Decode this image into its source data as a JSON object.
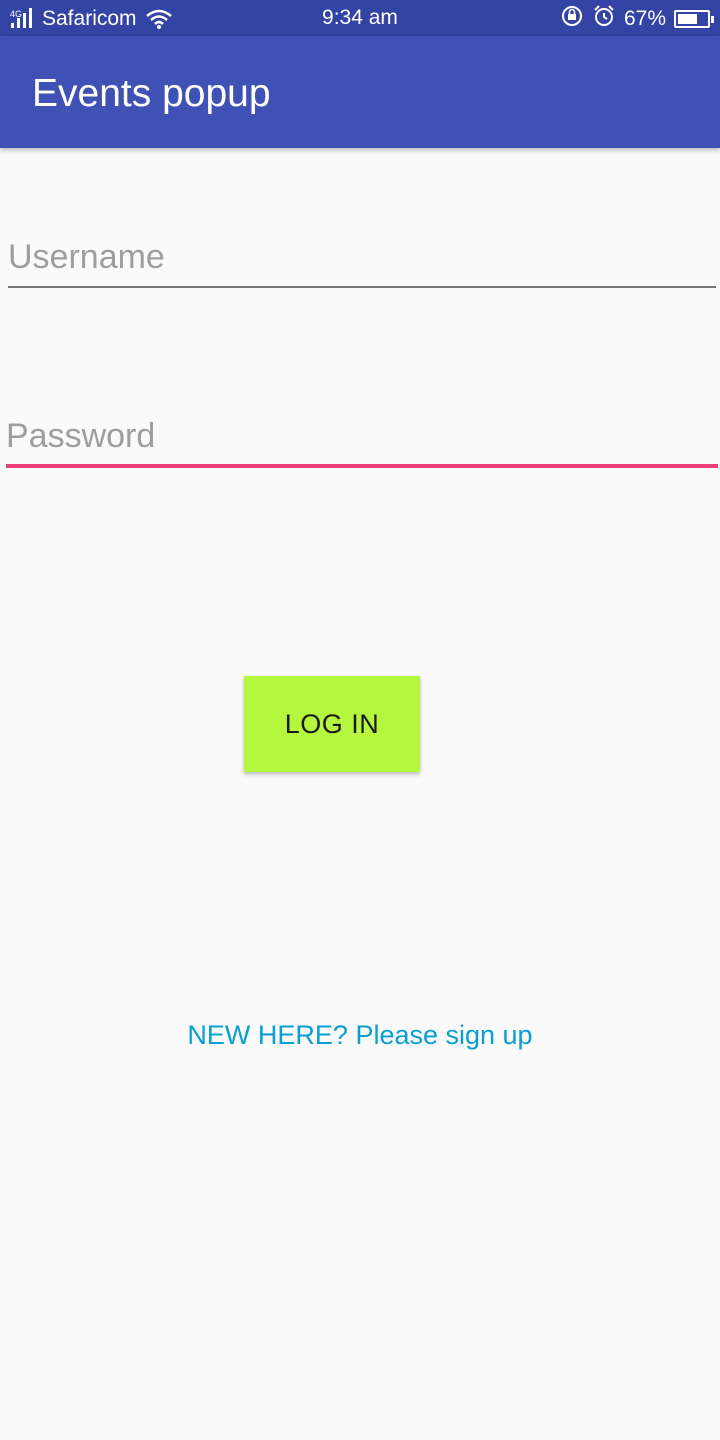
{
  "status_bar": {
    "network_type": "4G",
    "carrier": "Safaricom",
    "time": "9:34 am",
    "battery_percent": "67%",
    "battery_level": 0.67,
    "icons": [
      "signal-icon",
      "wifi-icon",
      "rotation-lock-icon",
      "alarm-icon",
      "battery-icon"
    ]
  },
  "app_bar": {
    "title": "Events popup",
    "color": "#3f51b5"
  },
  "form": {
    "username_placeholder": "Username",
    "username_value": "",
    "password_placeholder": "Password",
    "password_value": "",
    "focus_color": "#ec407a",
    "login_label": "LOG IN",
    "login_color": "#b5f73f",
    "signup_text": "NEW HERE? Please sign up",
    "signup_color": "#0a9fd2"
  }
}
